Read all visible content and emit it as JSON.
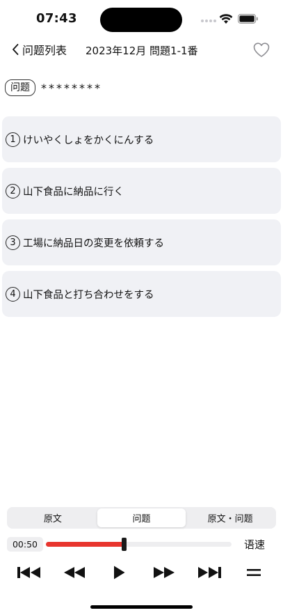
{
  "status_bar": {
    "time": "07:43"
  },
  "nav": {
    "back_label": "问题列表",
    "title": "2023年12月 問題1-1番"
  },
  "question": {
    "tag": "问题",
    "text": "********"
  },
  "options": [
    {
      "number": "1",
      "text": "けいやくしょをかくにんする"
    },
    {
      "number": "2",
      "text": "山下食品に納品に行く"
    },
    {
      "number": "3",
      "text": "工場に納品日の変更を依頼する"
    },
    {
      "number": "4",
      "text": "山下食品と打ち合わせをする"
    }
  ],
  "segments": {
    "items": [
      "原文",
      "问题",
      "原文・问题"
    ],
    "selected": 1
  },
  "player": {
    "current_time": "00:50",
    "progress": 0.42,
    "speed_label": "语速"
  },
  "colors": {
    "progress_fill": "#e8352e",
    "option_bg": "#f0f1f5"
  },
  "icons": {
    "back": "chevron-left-icon",
    "favorite": "heart-outline-icon",
    "skip_back": "skip-to-start-icon",
    "rewind": "rewind-icon",
    "play": "play-icon",
    "fast_forward": "fast-forward-icon",
    "skip_forward": "skip-to-end-icon",
    "menu": "equals-menu-icon"
  }
}
